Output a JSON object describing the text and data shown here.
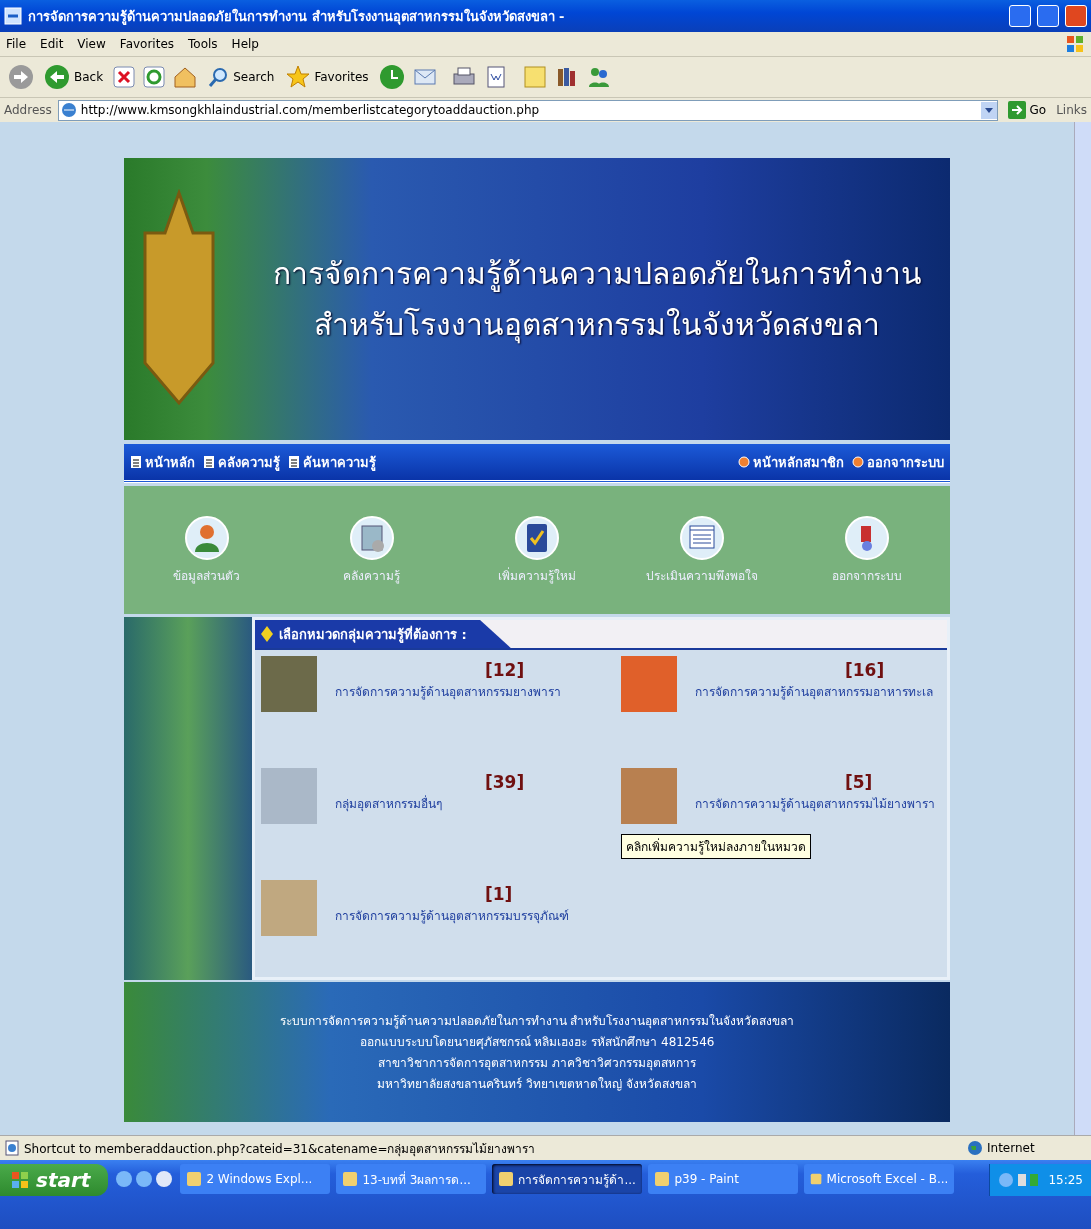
{
  "window": {
    "title": "การจัดการความรู้ด้านความปลอดภัยในการทำงาน สำหรับโรงงานอุตสาหกรรมในจังหวัดสงขลา -"
  },
  "menu": [
    "File",
    "Edit",
    "View",
    "Favorites",
    "Tools",
    "Help"
  ],
  "toolbar": {
    "back": "Back",
    "search": "Search",
    "favorites": "Favorites"
  },
  "address": {
    "label": "Address",
    "url": "http://www.kmsongkhlaindustrial.com/memberlistcategorytoaddauction.php",
    "go": "Go",
    "links": "Links"
  },
  "banner": {
    "lines": [
      "การจัดการความรู้ด้านความปลอดภัยในการทำงาน",
      "สำหรับโรงงานอุตสาหกรรมในจังหวัดสงขลา"
    ]
  },
  "nav": {
    "left": [
      "หน้าหลัก",
      "คลังความรู้",
      "ค้นหาความรู้"
    ],
    "right": [
      "หน้าหลักสมาชิก",
      "ออกจากระบบ"
    ]
  },
  "icon_menu": [
    {
      "label": "ข้อมูลส่วนตัว",
      "kind": "person"
    },
    {
      "label": "คลังความรู้",
      "kind": "archive"
    },
    {
      "label": "เพิ่มความรู้ใหม่",
      "kind": "edit"
    },
    {
      "label": "ประเมินความพึงพอใจ",
      "kind": "form"
    },
    {
      "label": "ออกจากระบบ",
      "kind": "exit"
    }
  ],
  "section": {
    "heading": "เลือกหมวดกลุ่มความรู้ที่ต้องการ :"
  },
  "categories": [
    {
      "count": "[12]",
      "name": "การจัดการความรู้ด้านอุตสาหกรรมยางพารา",
      "kind": "trees"
    },
    {
      "count": "[16]",
      "name": "การจัดการความรู้ด้านอุตสาหกรรมอาหารทะเล",
      "kind": "shrimp"
    },
    {
      "count": "[39]",
      "name": "กลุ่มอุตสาหกรรมอื่นๆ",
      "kind": "gears"
    },
    {
      "count": "[5]",
      "name": "การจัดการความรู้ด้านอุตสาหกรรมไม้ยางพารา",
      "kind": "wood",
      "tooltip": "คลิกเพิ่มความรู้ใหม่ลงภายในหมวด"
    },
    {
      "count": "[1]",
      "name": "การจัดการความรู้ด้านอุตสาหกรรมบรรจุภัณฑ์",
      "kind": "boxes"
    }
  ],
  "footer": {
    "lines": [
      "ระบบการจัดการความรู้ด้านความปลอดภัยในการทำงาน สำหรับโรงงานอุตสาหกรรมในจังหวัดสงขลา",
      "ออกแบบระบบโดยนายศุภัสชกรณ์ หลิมเฮงฮะ รหัสนักศึกษา 4812546",
      "สาขาวิชาการจัดการอุตสาหกรรม ภาควิชาวิศวกรรมอุตสหการ",
      "มหาวิทยาลัยสงขลานครินทร์ วิทยาเขตหาดใหญ่ จังหวัดสงขลา"
    ]
  },
  "status_bar": {
    "text": "Shortcut to memberaddauction.php?cateid=31&catename=กลุ่มอุตสาหกรรมไม้ยางพารา",
    "zone": "Internet"
  },
  "taskbar": {
    "start": "start",
    "tasks": [
      {
        "label": "2 Windows Expl...",
        "selected": false
      },
      {
        "label": "13-บทที่ 3ผลการด...",
        "selected": false
      },
      {
        "label": "การจัดการความรู้ด้า...",
        "selected": true
      },
      {
        "label": "p39 - Paint",
        "selected": false
      },
      {
        "label": "Microsoft Excel - B...",
        "selected": false
      }
    ],
    "clock": "15:25"
  }
}
